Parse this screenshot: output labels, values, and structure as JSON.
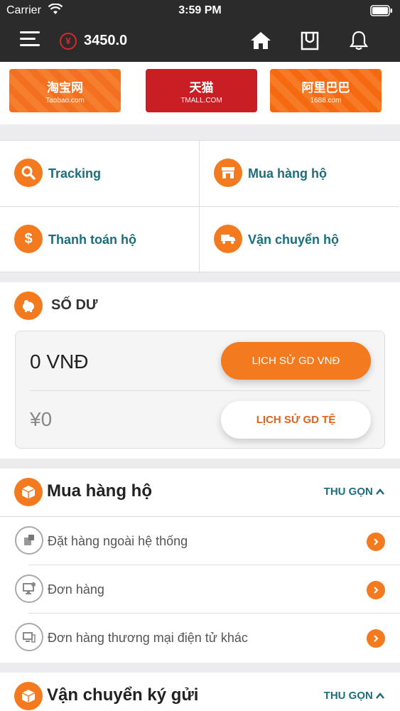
{
  "status_bar": {
    "carrier": "Carrier",
    "time": "3:59 PM"
  },
  "navbar": {
    "currency_symbol": "¥",
    "balance": "3450.0"
  },
  "banners": [
    {
      "top": "淘宝网",
      "bottom": "Taobao.com"
    },
    {
      "top": "天猫",
      "bottom": "TMALL.COM"
    },
    {
      "top": "阿里巴巴",
      "bottom": "1688.com"
    }
  ],
  "services": [
    {
      "label": "Tracking",
      "icon": "search-icon"
    },
    {
      "label": "Mua hàng hộ",
      "icon": "store-icon"
    },
    {
      "label": "Thanh toán hộ",
      "icon": "dollar-icon"
    },
    {
      "label": "Vận chuyển hộ",
      "icon": "truck-icon"
    }
  ],
  "wallet": {
    "title": "SỐ DƯ",
    "vnd_amount": "0 VNĐ",
    "vnd_button": "LỊCH SỬ GD VNĐ",
    "cny_amount": "¥0",
    "cny_button": "LỊCH SỬ GD TỆ"
  },
  "buy_section": {
    "title": "Mua hàng hộ",
    "collapse": "THU GỌN",
    "rows": [
      {
        "label": "Đặt hàng ngoài hệ thống"
      },
      {
        "label": "Đơn hàng"
      },
      {
        "label": "Đơn hàng thương mại điện tử khác"
      }
    ]
  },
  "ship_section": {
    "title": "Vận chuyển ký gửi",
    "collapse": "THU GỌN"
  },
  "colors": {
    "accent": "#f47a20",
    "teal": "#1d6e7a",
    "nav_bg": "#2b2b2b"
  }
}
